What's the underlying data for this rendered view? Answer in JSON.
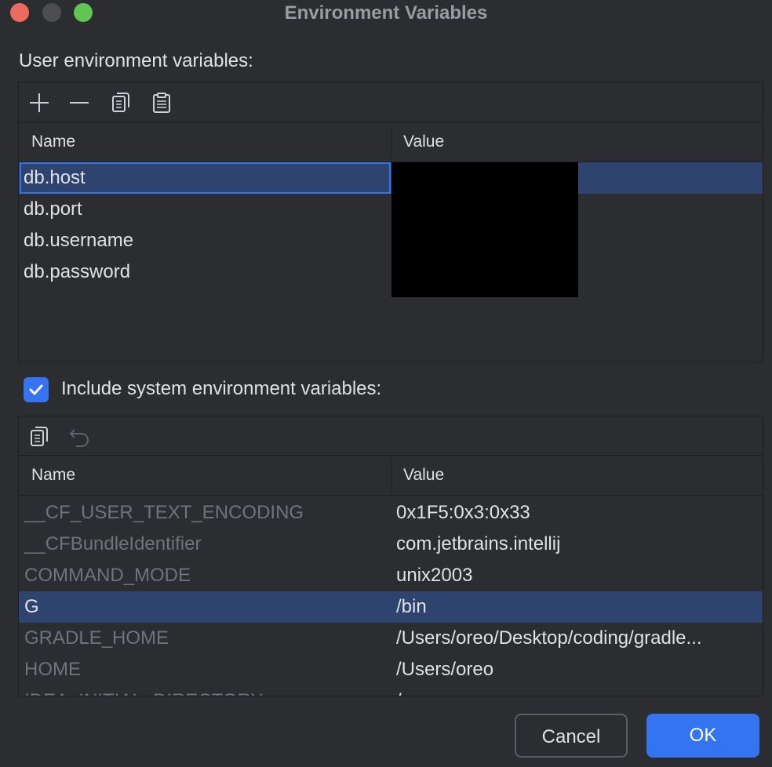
{
  "window": {
    "title": "Environment Variables"
  },
  "user_section": {
    "label": "User environment variables:",
    "columns": {
      "name": "Name",
      "value": "Value"
    },
    "rows": [
      {
        "name": "db.host",
        "value": ""
      },
      {
        "name": "db.port",
        "value": ""
      },
      {
        "name": "db.username",
        "value": ""
      },
      {
        "name": "db.password",
        "value": ""
      }
    ]
  },
  "system_section": {
    "checkbox_label": "Include system environment variables:",
    "checked": true,
    "columns": {
      "name": "Name",
      "value": "Value"
    },
    "rows": [
      {
        "name": "__CF_USER_TEXT_ENCODING",
        "value": "0x1F5:0x3:0x33"
      },
      {
        "name": "__CFBundleIdentifier",
        "value": "com.jetbrains.intellij"
      },
      {
        "name": "COMMAND_MODE",
        "value": "unix2003"
      },
      {
        "name": "G",
        "value": "/bin"
      },
      {
        "name": "GRADLE_HOME",
        "value": "/Users/oreo/Desktop/coding/gradle..."
      },
      {
        "name": "HOME",
        "value": "/Users/oreo"
      },
      {
        "name": "IDEA_INITIAL_DIRECTORY",
        "value": "/"
      }
    ]
  },
  "buttons": {
    "cancel": "Cancel",
    "ok": "OK"
  },
  "colors": {
    "accent": "#3574f0",
    "selection": "#2e436e",
    "background": "#2b2d30"
  }
}
